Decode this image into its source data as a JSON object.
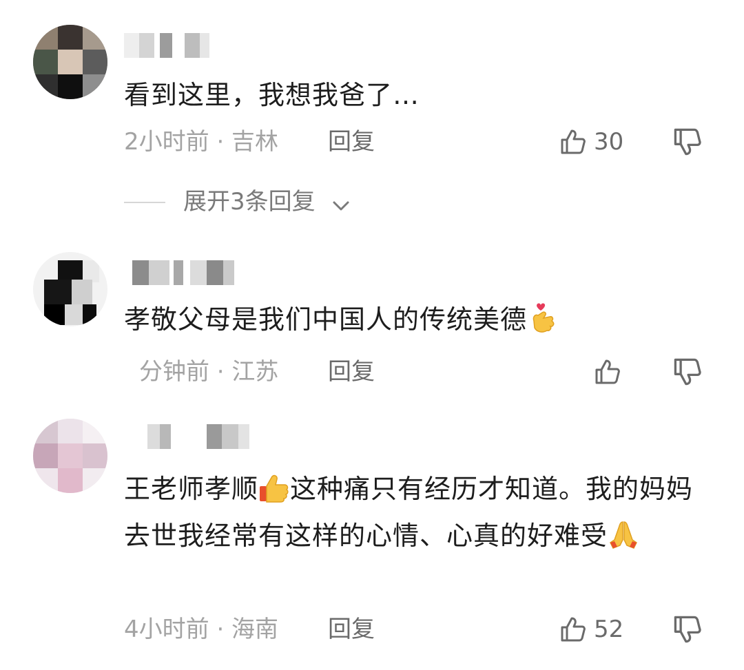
{
  "comments": [
    {
      "text": "看到这里，我想我爸了…",
      "meta": "2小时前 · 吉林",
      "reply_label": "回复",
      "like_count": "30"
    },
    {
      "text": "孝敬父母是我们中国人的传统美德",
      "emoji_after_text": "finger-heart-emoji",
      "meta": "分钟前 · 江苏",
      "reply_label": "回复",
      "like_count": ""
    },
    {
      "text_part1": "王老师孝顺",
      "emoji_mid": "thumbs-up-emoji",
      "text_part2": "这种痛只有经历才知道。我的妈妈去世我经常有这样的心情、心真的好难受",
      "emoji_end": "folded-hands-emoji",
      "meta": "4小时前 · 海南",
      "reply_label": "回复",
      "like_count": "52"
    }
  ],
  "expand_replies": {
    "label": "展开3条回复"
  },
  "icons": {
    "like": "thumbs-up-outline-icon",
    "dislike": "thumbs-down-outline-icon",
    "expand": "chevron-down-icon"
  },
  "colors": {
    "text": "#1d1d1d",
    "meta": "#a3a3a3",
    "action": "#6a6a6a"
  }
}
